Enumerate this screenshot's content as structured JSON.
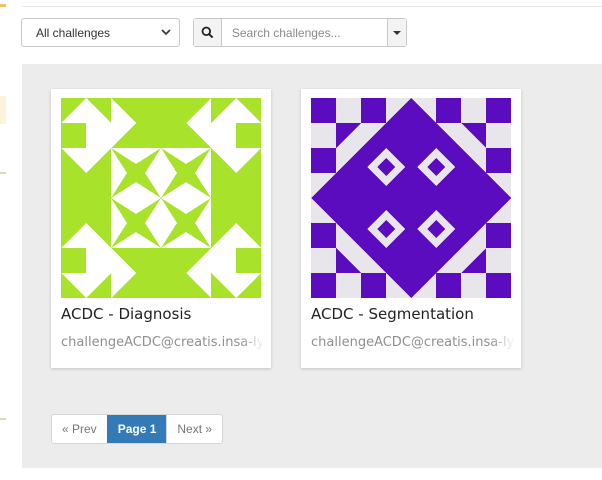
{
  "filter": {
    "select_value": "All challenges",
    "search_placeholder": "Search challenges..."
  },
  "icons": {
    "search": "search-icon",
    "dropdown": "caret-down-icon",
    "select": "chevron-down-icon"
  },
  "cards": [
    {
      "title": "ACDC - Diagnosis",
      "email": "challengeACDC@creatis.insa-lyon.fr",
      "color": "#a8e22a"
    },
    {
      "title": "ACDC - Segmentation",
      "email": "challengeACDC@creatis.insa-lyon.fr",
      "color": "#5b0cbf"
    }
  ],
  "pagination": {
    "prev": "« Prev",
    "current": "Page 1",
    "next": "Next »"
  },
  "colors": {
    "panel": "#ececec",
    "pager_active": "#337ab7",
    "diagnosis_accent": "#a8e22a",
    "segmentation_accent": "#5b0cbf"
  }
}
